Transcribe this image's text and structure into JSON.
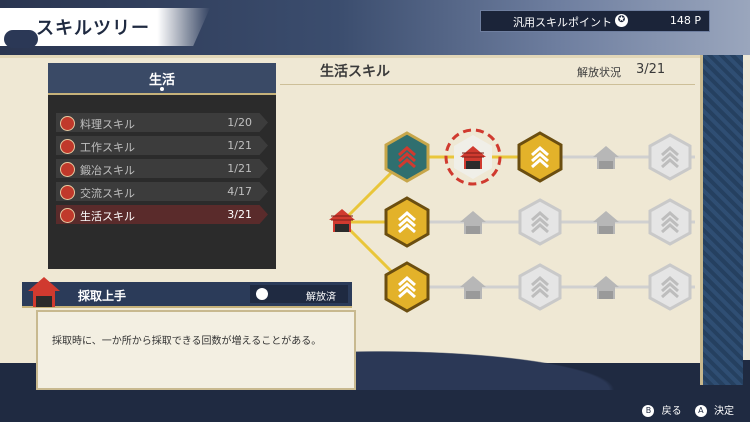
{
  "header": {
    "title": "スキルツリー",
    "points_label": "汎用スキルポイント",
    "points_value": "148 P"
  },
  "tree": {
    "title": "生活スキル",
    "release_label": "解放状況",
    "release_value": "3/21"
  },
  "categories": {
    "title": "生活",
    "items": [
      {
        "name": "料理スキル",
        "count": "1/20"
      },
      {
        "name": "工作スキル",
        "count": "1/21"
      },
      {
        "name": "鍛冶スキル",
        "count": "1/21"
      },
      {
        "name": "交流スキル",
        "count": "4/17"
      },
      {
        "name": "生活スキル",
        "count": "3/21"
      }
    ]
  },
  "detail": {
    "name": "採取上手",
    "state": "解放済",
    "description": "採取時に、一か所から採取できる回数が増えることがある。"
  },
  "footer": {
    "back_label": "戻る",
    "confirm_label": "決定",
    "back_icon": "B",
    "confirm_icon": "A"
  },
  "colors": {
    "unlocked_gold": "#e3b22a",
    "unlocked_teal": "#2f6f6f",
    "locked": "#c9c9c9",
    "accent_red": "#d03a2f",
    "navy": "#2b3b59"
  }
}
